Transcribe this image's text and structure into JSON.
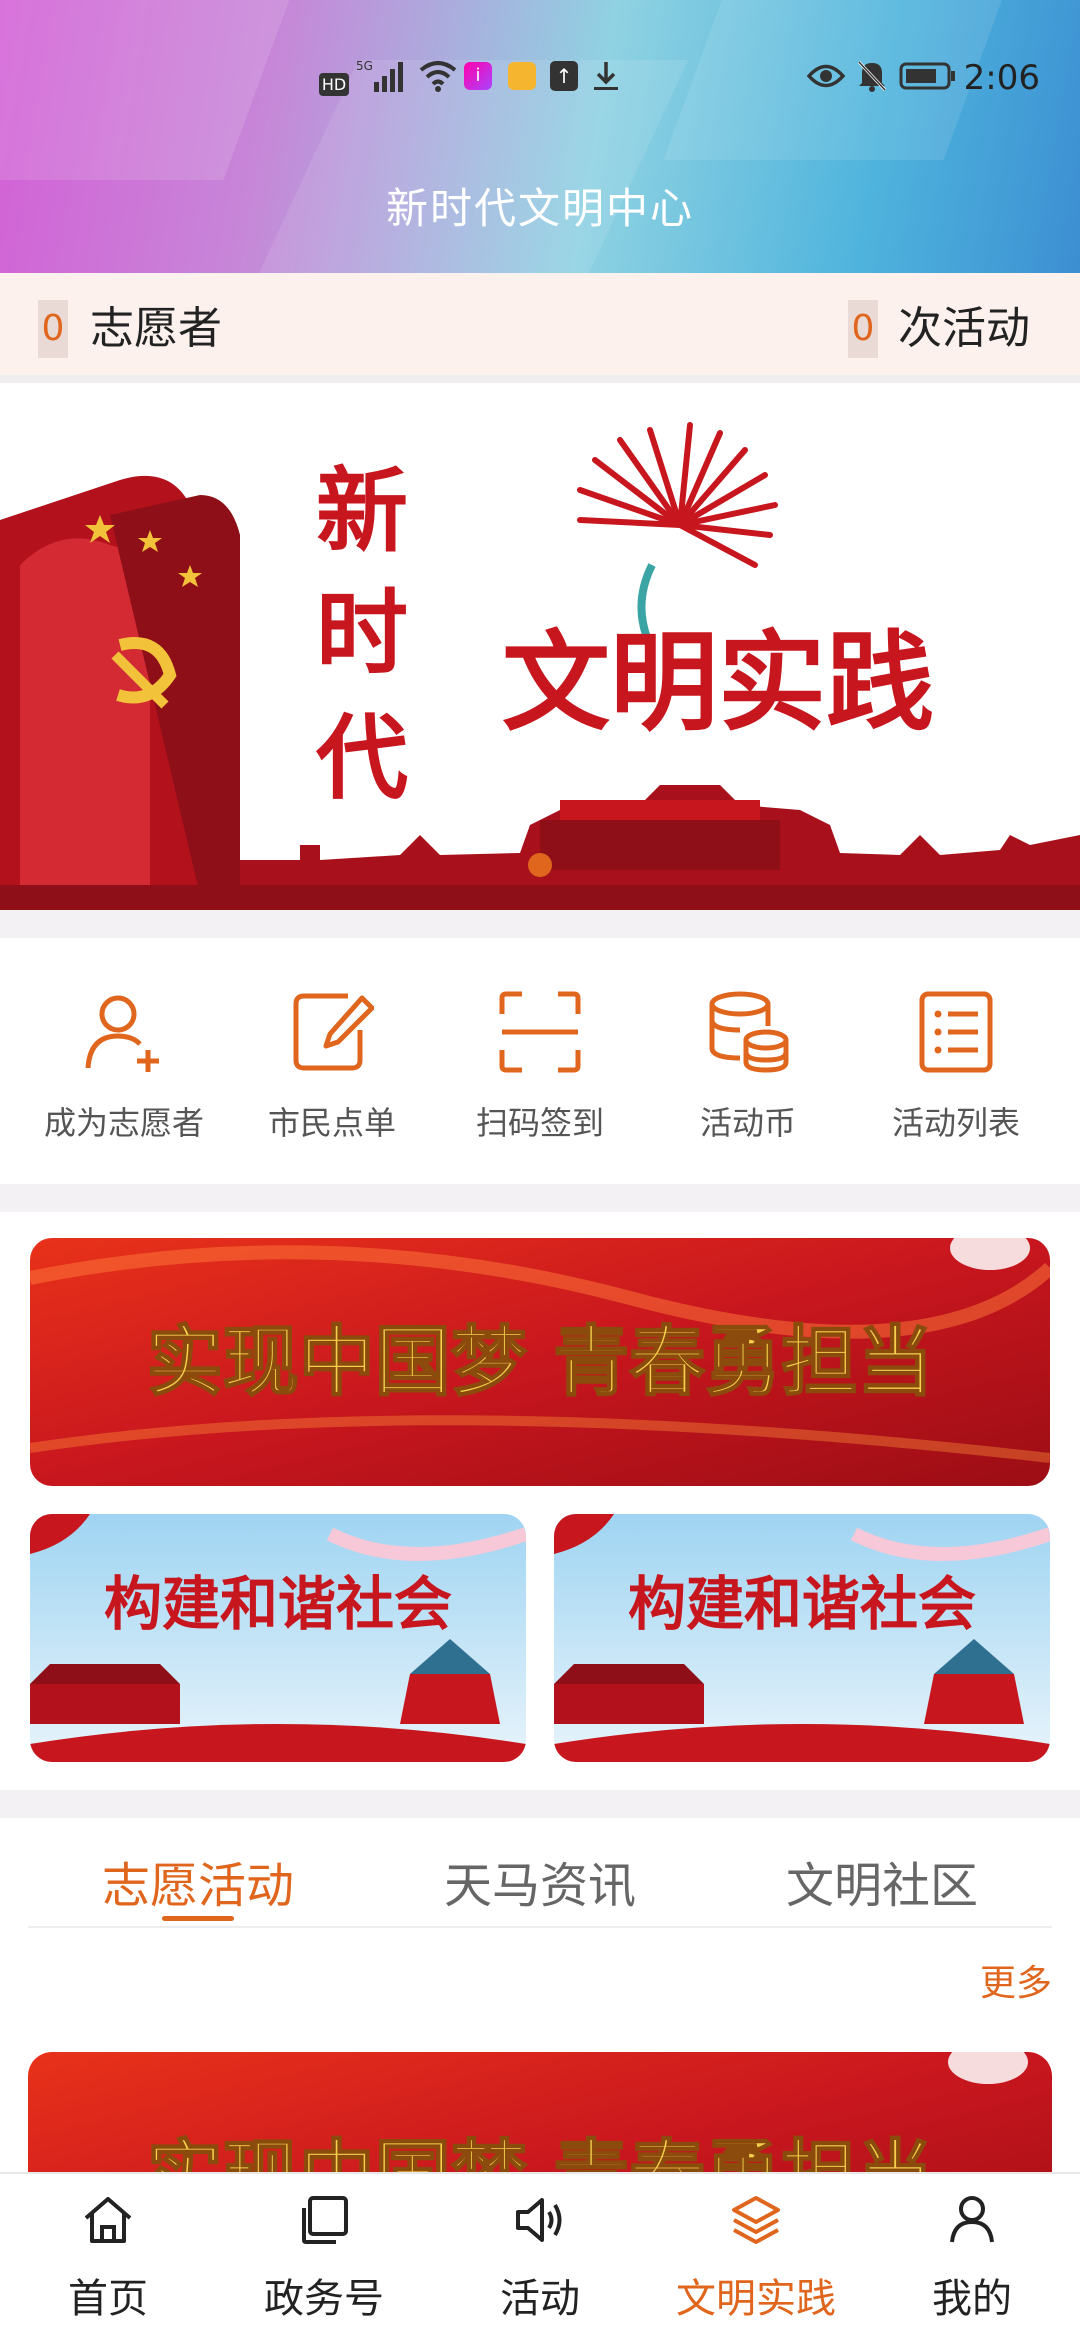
{
  "status_bar": {
    "time": "2:06",
    "network": "5G",
    "hd": "HD"
  },
  "header": {
    "title": "新时代文明中心"
  },
  "stats": {
    "volunteers_count": "0",
    "volunteers_label": "志愿者",
    "activities_count": "0",
    "activities_label": "次活动"
  },
  "banner": {
    "vertical_text": [
      "新",
      "时",
      "代"
    ],
    "main_text": "文明实践"
  },
  "quick_actions": [
    {
      "label": "成为志愿者",
      "icon": "add-user-icon"
    },
    {
      "label": "市民点单",
      "icon": "edit-note-icon"
    },
    {
      "label": "扫码签到",
      "icon": "scan-icon"
    },
    {
      "label": "活动币",
      "icon": "coins-icon"
    },
    {
      "label": "活动列表",
      "icon": "list-icon"
    }
  ],
  "promo": {
    "big_text": "实现中国梦 青春勇担当",
    "small_text": "构建和谐社会"
  },
  "tabs": [
    {
      "label": "志愿活动",
      "active": true
    },
    {
      "label": "天马资讯",
      "active": false
    },
    {
      "label": "文明社区",
      "active": false
    }
  ],
  "more_label": "更多",
  "bottom_nav": [
    {
      "label": "首页",
      "icon": "home-icon",
      "active": false
    },
    {
      "label": "政务号",
      "icon": "copy-icon",
      "active": false
    },
    {
      "label": "活动",
      "icon": "speaker-icon",
      "active": false
    },
    {
      "label": "文明实践",
      "icon": "layers-icon",
      "active": true
    },
    {
      "label": "我的",
      "icon": "user-icon",
      "active": false
    }
  ],
  "colors": {
    "accent": "#e0651d",
    "red": "#c8161e",
    "gold": "#f6d04d"
  }
}
